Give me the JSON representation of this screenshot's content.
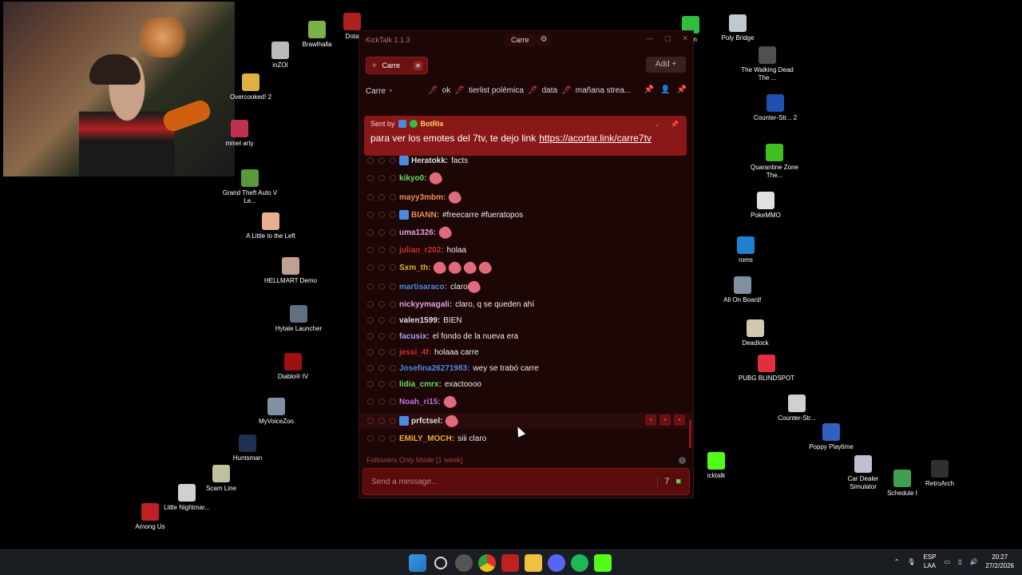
{
  "desktop_icons": [
    {
      "label": "Brawlhalla",
      "icon": "brawlhalla-icon",
      "color": "#7bb04a"
    },
    {
      "label": "Dota",
      "icon": "dota-icon",
      "color": "#b02020"
    },
    {
      "label": "inZOI",
      "icon": "inzoi-icon",
      "color": "#bbbbbb"
    },
    {
      "label": "Overcooked! 2",
      "icon": "overcooked-icon",
      "color": "#e0b040"
    },
    {
      "label": "mmel arty",
      "icon": "app-icon",
      "color": "#c03050"
    },
    {
      "label": "Grand Theft Auto V Le...",
      "icon": "gta-icon",
      "color": "#5a9a3a"
    },
    {
      "label": "A Little to the Left",
      "icon": "little-left-icon",
      "color": "#e8b090"
    },
    {
      "label": "HELLMART Demo",
      "icon": "hellmart-icon",
      "color": "#c0a090"
    },
    {
      "label": "Hytale Launcher",
      "icon": "hytale-icon",
      "color": "#607080"
    },
    {
      "label": "Diablo® IV",
      "icon": "diablo-icon",
      "color": "#a01010"
    },
    {
      "label": "MyVoiceZoo",
      "icon": "myvoicezoo-icon",
      "color": "#8090a0"
    },
    {
      "label": "Huntsman",
      "icon": "huntsman-icon",
      "color": "#203050"
    },
    {
      "label": "Scam Line",
      "icon": "scamline-icon",
      "color": "#c0c0a0"
    },
    {
      "label": "Little Nightmar...",
      "icon": "little-nightmares-icon",
      "color": "#d0d0d0"
    },
    {
      "label": "Among Us",
      "icon": "among-us-icon",
      "color": "#c02020"
    },
    {
      "label": "drun",
      "icon": "tree-icon",
      "color": "#30c040"
    },
    {
      "label": "Poly Bridge",
      "icon": "poly-bridge-icon",
      "color": "#c0c8d0"
    },
    {
      "label": "The Walking Dead The ...",
      "icon": "walking-dead-icon",
      "color": "#505050"
    },
    {
      "label": "Counter-Str... 2",
      "icon": "cs2-icon",
      "color": "#2050b0"
    },
    {
      "label": "Quarantine Zone The...",
      "icon": "quarantine-icon",
      "color": "#40c020"
    },
    {
      "label": "PokeMMO",
      "icon": "pokemmo-icon",
      "color": "#e0e0e0"
    },
    {
      "label": "roms",
      "icon": "ie-icon",
      "color": "#2080d0"
    },
    {
      "label": "All On Board!",
      "icon": "all-on-board-icon",
      "color": "#8090a0"
    },
    {
      "label": "Deadlock",
      "icon": "deadlock-icon",
      "color": "#d0c8b0"
    },
    {
      "label": "PUBG BLINDSPOT",
      "icon": "pubg-icon",
      "color": "#e03040"
    },
    {
      "label": "Counter-Str...",
      "icon": "cs-icon",
      "color": "#d0d0d0"
    },
    {
      "label": "icktalk",
      "icon": "kick-icon",
      "color": "#53fc18"
    },
    {
      "label": "Poppy Playtime",
      "icon": "poppy-icon",
      "color": "#3060c0"
    },
    {
      "label": "Car Dealer Simulator",
      "icon": "car-dealer-icon",
      "color": "#c0c0d0"
    },
    {
      "label": "Schedule I",
      "icon": "schedule-icon",
      "color": "#40a050"
    },
    {
      "label": "RetroArch",
      "icon": "retroarch-icon",
      "color": "#303030"
    }
  ],
  "kicktalk": {
    "title": "KickTalk 1.1.3",
    "channel_pill": "Carre",
    "tab_label": "Carre",
    "add_label": "Add +",
    "channel_name": "Carre",
    "pinned_keywords": [
      "ok",
      "tierlist polémica",
      "data",
      "mañana strea..."
    ],
    "pinned": {
      "sent_by": "Sent by",
      "bot_name": "BotRix",
      "text": "para ver los emotes del 7tv, te dejo link",
      "link": "https://acortar.link/carre7tv"
    },
    "messages": [
      {
        "user": "Heratokk:",
        "color": "#e0e0e0",
        "text": "facts",
        "emotes": 0
      },
      {
        "user": "kikyo0:",
        "color": "#66dd66",
        "text": "",
        "emotes": 1
      },
      {
        "user": "mayy3mbm:",
        "color": "#e89050",
        "text": "",
        "emotes": 1
      },
      {
        "user": "BIANN:",
        "color": "#e89050",
        "text": "#freecarre #fueratopos",
        "emotes": 0
      },
      {
        "user": "uma1326:",
        "color": "#e0a0e0",
        "text": "",
        "emotes": 1
      },
      {
        "user": "julian_r202:",
        "color": "#cc3030",
        "text": "holaa",
        "emotes": 0
      },
      {
        "user": "Sxm_th:",
        "color": "#e8b030",
        "text": "",
        "emotes": 4
      },
      {
        "user": "martisaraco:",
        "color": "#4a8ae0",
        "text": "claro",
        "emotes": 1
      },
      {
        "user": "nickyymagali:",
        "color": "#e0a0e0",
        "text": "claro, q se queden ahí",
        "emotes": 0
      },
      {
        "user": "valen1599:",
        "color": "#e0e0e0",
        "text": "BIEN",
        "emotes": 0
      },
      {
        "user": "facusix:",
        "color": "#b0a0ff",
        "text": "el fondo de la nueva era",
        "emotes": 0
      },
      {
        "user": "jessi_4f:",
        "color": "#cc3030",
        "text": "holaaa carre",
        "emotes": 0
      },
      {
        "user": "Josefina26271983:",
        "color": "#4a8ae0",
        "text": "wey se trabó carre",
        "emotes": 0
      },
      {
        "user": "lidia_cmrx:",
        "color": "#66dd66",
        "text": "exactoooo",
        "emotes": 0
      },
      {
        "user": "Noah_ri15:",
        "color": "#c070e0",
        "text": "",
        "emotes": 1
      },
      {
        "user": "prfctsel:",
        "color": "#e0e0e0",
        "text": "",
        "emotes": 1
      },
      {
        "user": "EMiLY_MOCH:",
        "color": "#e8b030",
        "text": "siii claro",
        "emotes": 0
      }
    ],
    "status": "Followers Only Mode [1 week]",
    "input_placeholder": "Send a message..."
  },
  "taskbar": {
    "lang_top": "ESP",
    "lang_bottom": "LAA",
    "time": "20:27",
    "date": "27/2/2026"
  }
}
